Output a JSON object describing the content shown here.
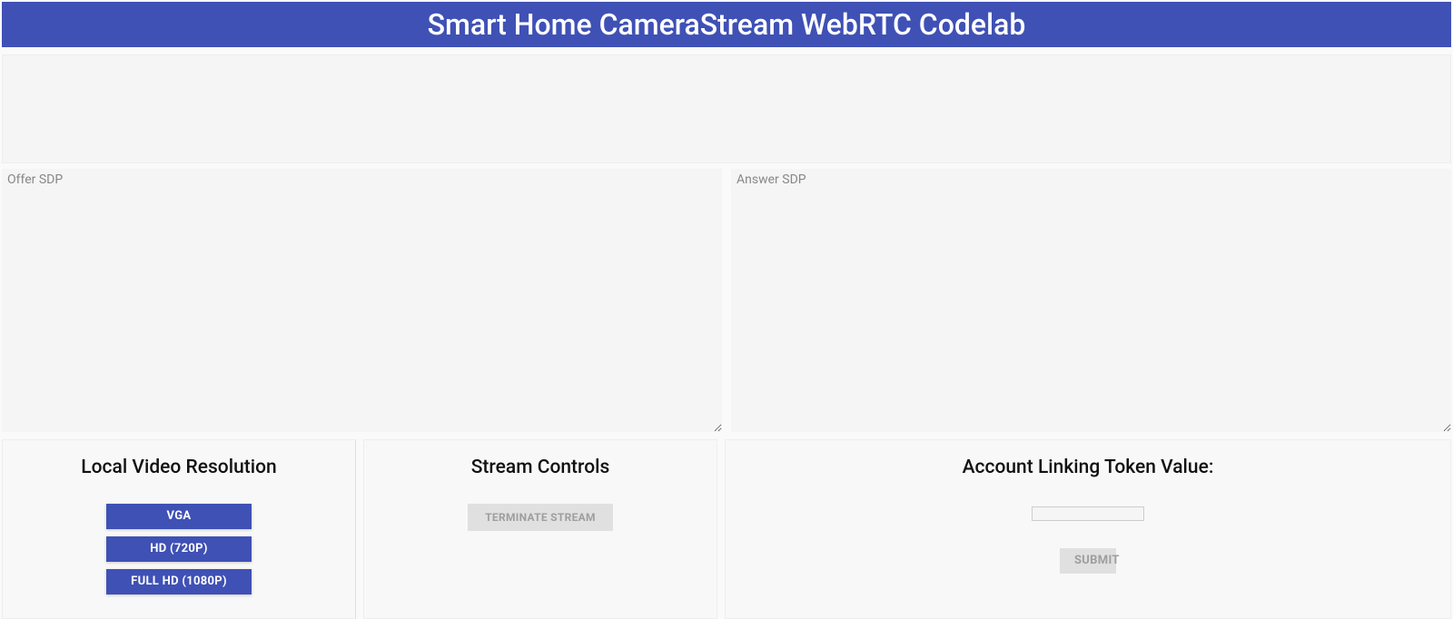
{
  "header": {
    "title": "Smart Home CameraStream WebRTC Codelab"
  },
  "sdp": {
    "offer_placeholder": "Offer SDP",
    "offer_value": "",
    "answer_placeholder": "Answer SDP",
    "answer_value": ""
  },
  "resolution": {
    "title": "Local Video Resolution",
    "buttons": [
      {
        "label": "VGA"
      },
      {
        "label": "HD (720P)"
      },
      {
        "label": "FULL HD (1080P)"
      }
    ]
  },
  "stream": {
    "title": "Stream Controls",
    "terminate_label": "TERMINATE STREAM"
  },
  "token": {
    "title": "Account Linking Token Value:",
    "value": "",
    "submit_label": "SUBMIT"
  }
}
